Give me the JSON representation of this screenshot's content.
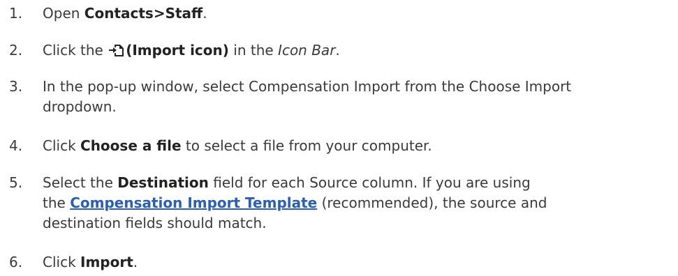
{
  "steps": [
    {
      "number": "1.",
      "parts": {
        "pre": "Open ",
        "bold": "Contacts>Staff",
        "post": "."
      }
    },
    {
      "number": "2.",
      "parts": {
        "pre": "Click the ",
        "icon": "import-icon",
        "bold": "(Import icon)",
        "mid": " in the ",
        "italic": "Icon Bar",
        "post": "."
      }
    },
    {
      "number": "3.",
      "line1": "In the pop-up window, select Compensation Import from the Choose Import",
      "line2": "dropdown."
    },
    {
      "number": "4.",
      "parts": {
        "pre": "Click ",
        "bold": "Choose a file",
        "post": " to select a file from your computer."
      }
    },
    {
      "number": "5.",
      "parts": {
        "pre": "Select the ",
        "bold": "Destination",
        "post": " field for each Source column. If you are using",
        "line2_pre": "the ",
        "link": "Compensation Import Template",
        "line2_post": " (recommended), the source and",
        "line3": "destination fields should match."
      }
    },
    {
      "number": "6.",
      "parts": {
        "pre": "Click ",
        "bold": "Import",
        "post": "."
      }
    }
  ],
  "colors": {
    "text": "#3a3a3a",
    "link": "#2a5fb4"
  }
}
